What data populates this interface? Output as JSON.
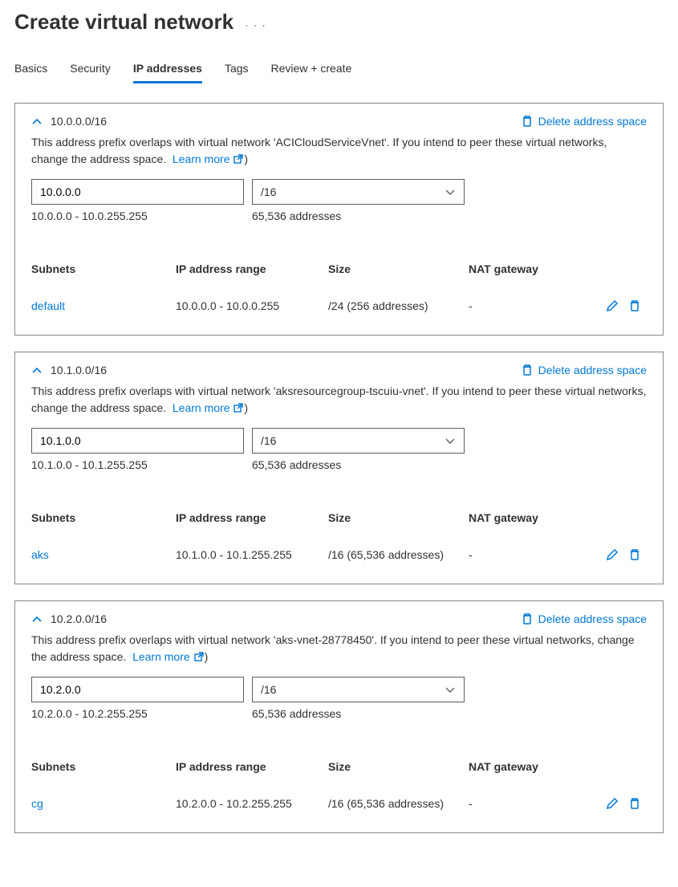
{
  "title": "Create virtual network",
  "tabs": [
    "Basics",
    "Security",
    "IP addresses",
    "Tags",
    "Review + create"
  ],
  "active_tab_index": 2,
  "delete_label": "Delete address space",
  "learn_more_label": "Learn more",
  "table_headers": {
    "subnets": "Subnets",
    "range": "IP address range",
    "size": "Size",
    "nat": "NAT gateway"
  },
  "spaces": [
    {
      "cidr": "10.0.0.0/16",
      "overlap_text": "This address prefix overlaps with virtual network 'ACICloudServiceVnet'. If you intend to peer these virtual networks, change the address space.",
      "ip_value": "10.0.0.0",
      "mask_value": "/16",
      "range_text": "10.0.0.0 - 10.0.255.255",
      "count_text": "65,536 addresses",
      "subnets": [
        {
          "name": "default",
          "range": "10.0.0.0 - 10.0.0.255",
          "size": "/24 (256 addresses)",
          "nat": "-"
        }
      ]
    },
    {
      "cidr": "10.1.0.0/16",
      "overlap_text": "This address prefix overlaps with virtual network 'aksresourcegroup-tscuiu-vnet'. If you intend to peer these virtual networks, change the address space.",
      "ip_value": "10.1.0.0",
      "mask_value": "/16",
      "range_text": "10.1.0.0 - 10.1.255.255",
      "count_text": "65,536 addresses",
      "subnets": [
        {
          "name": "aks",
          "range": "10.1.0.0 - 10.1.255.255",
          "size": "/16 (65,536 addresses)",
          "nat": "-"
        }
      ]
    },
    {
      "cidr": "10.2.0.0/16",
      "overlap_text": "This address prefix overlaps with virtual network 'aks-vnet-28778450'. If you intend to peer these virtual networks, change the address space.",
      "ip_value": "10.2.0.0",
      "mask_value": "/16",
      "range_text": "10.2.0.0 - 10.2.255.255",
      "count_text": "65,536 addresses",
      "subnets": [
        {
          "name": "cg",
          "range": "10.2.0.0 - 10.2.255.255",
          "size": "/16 (65,536 addresses)",
          "nat": "-"
        }
      ]
    }
  ]
}
